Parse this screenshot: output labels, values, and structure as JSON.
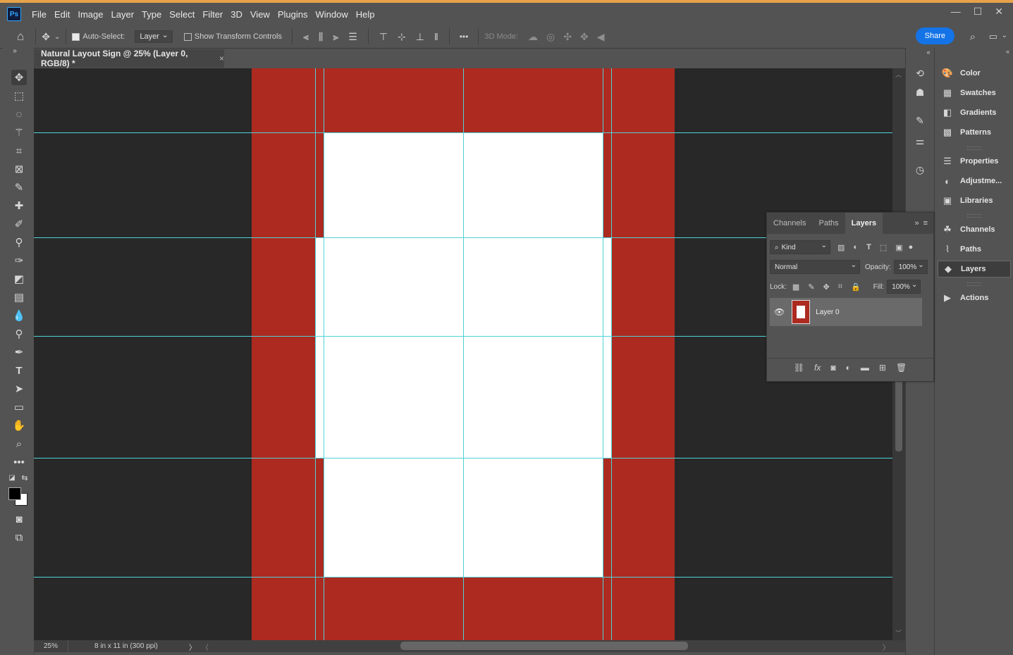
{
  "app": {
    "logo": "Ps",
    "menu": [
      "File",
      "Edit",
      "Image",
      "Layer",
      "Type",
      "Select",
      "Filter",
      "3D",
      "View",
      "Plugins",
      "Window",
      "Help"
    ],
    "window_controls": [
      "—",
      "☐",
      "✕"
    ]
  },
  "options_bar": {
    "auto_select_label": "Auto-Select:",
    "auto_select_checked": true,
    "auto_select_target": "Layer",
    "show_transform_label": "Show Transform Controls",
    "show_transform_checked": false,
    "mode_3d_label": "3D Mode:",
    "more_label": "•••",
    "share_label": "Share"
  },
  "document": {
    "tab_title": "Natural Layout Sign @ 25% (Layer 0, RGB/8) *",
    "close_glyph": "×",
    "background_color": "#ad2a20",
    "fill_color": "#ffffff",
    "guide_color": "#4fd2d8"
  },
  "status_bar": {
    "zoom": "25%",
    "doc_info": "8 in x 11 in (300 ppi)",
    "arrow_right": "〉",
    "arrow_left": "〈"
  },
  "right_dock": {
    "items": [
      {
        "label": "Color",
        "icon": "color-palette-icon",
        "glyph": "🎨"
      },
      {
        "label": "Swatches",
        "icon": "swatches-grid-icon",
        "glyph": "▦"
      },
      {
        "label": "Gradients",
        "icon": "gradient-icon",
        "glyph": "◧"
      },
      {
        "label": "Patterns",
        "icon": "patterns-icon",
        "glyph": "▩"
      },
      {
        "label": "Properties",
        "icon": "properties-sliders-icon",
        "glyph": "☰"
      },
      {
        "label": "Adjustme...",
        "icon": "adjustments-icon",
        "glyph": "◐"
      },
      {
        "label": "Libraries",
        "icon": "libraries-icon",
        "glyph": "▣"
      },
      {
        "label": "Channels",
        "icon": "channels-icon",
        "glyph": "☘"
      },
      {
        "label": "Paths",
        "icon": "paths-icon",
        "glyph": "⌇"
      },
      {
        "label": "Layers",
        "icon": "layers-icon",
        "glyph": "◆"
      },
      {
        "label": "Actions",
        "icon": "actions-play-icon",
        "glyph": "▶"
      }
    ]
  },
  "layers_panel": {
    "tabs": [
      "Channels",
      "Paths",
      "Layers"
    ],
    "active_tab": "Layers",
    "filter_kind": "Kind",
    "blend_mode": "Normal",
    "opacity_label": "Opacity:",
    "opacity_value": "100%",
    "lock_label": "Lock:",
    "fill_label": "Fill:",
    "fill_value": "100%",
    "layers": [
      {
        "name": "Layer 0",
        "visible": true
      }
    ]
  }
}
